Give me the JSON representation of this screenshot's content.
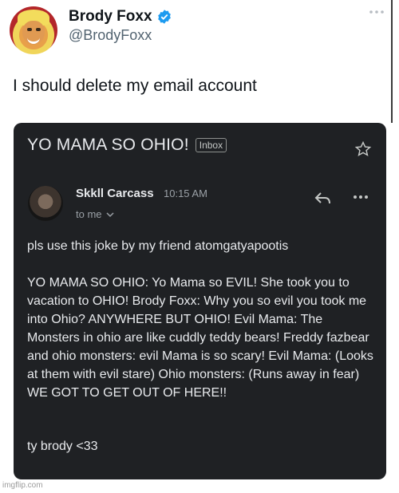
{
  "tweet": {
    "display_name": "Brody Foxx",
    "handle": "@BrodyFoxx",
    "text": "I should delete my email account",
    "verified_color": "#1d9bf0"
  },
  "email": {
    "subject": "YO MAMA SO OHIO!",
    "label": "Inbox",
    "sender_name": "Skkll Carcass",
    "time": "10:15 AM",
    "recipient": "to me",
    "body_intro": "pls use this joke by my friend atomgatyapootis",
    "body_main": "YO MAMA SO OHIO: Yo Mama so EVIL! She took you to vacation to OHIO! Brody Foxx: Why you so evil you took me into Ohio? ANYWHERE BUT OHIO! Evil Mama: The Monsters in ohio are like cuddly teddy bears! Freddy fazbear and ohio monsters: evil Mama is so scary! Evil Mama: (Looks at them with evil stare) Ohio monsters: (Runs away in fear) WE GOT TO GET OUT OF HERE!!",
    "signoff": "ty brody <33"
  },
  "watermark": "imgflip.com",
  "icons": [
    "verified-icon",
    "more-horizontal-icon",
    "star-icon",
    "reply-icon",
    "more-icon",
    "chevron-down-icon"
  ]
}
